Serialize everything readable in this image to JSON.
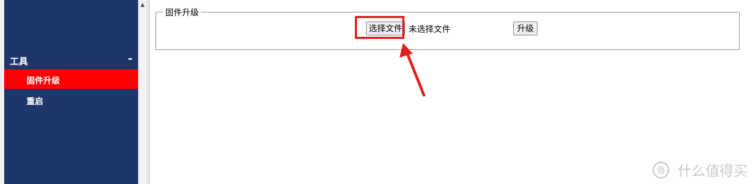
{
  "sidebar": {
    "section_title": "工具",
    "collapse_symbol": "-",
    "items": [
      {
        "label": "固件升级",
        "active": true
      },
      {
        "label": "重启",
        "active": false
      }
    ]
  },
  "main": {
    "fieldset_legend": "固件升级",
    "choose_file_label": "选择文件",
    "file_status": "未选择文件",
    "upgrade_label": "升级"
  },
  "watermark": {
    "text": "什么值得买",
    "logo": "值"
  },
  "colors": {
    "sidebar_bg": "#1f3669",
    "active_item_bg": "#ff0000",
    "annotation_red": "#e0201b"
  }
}
